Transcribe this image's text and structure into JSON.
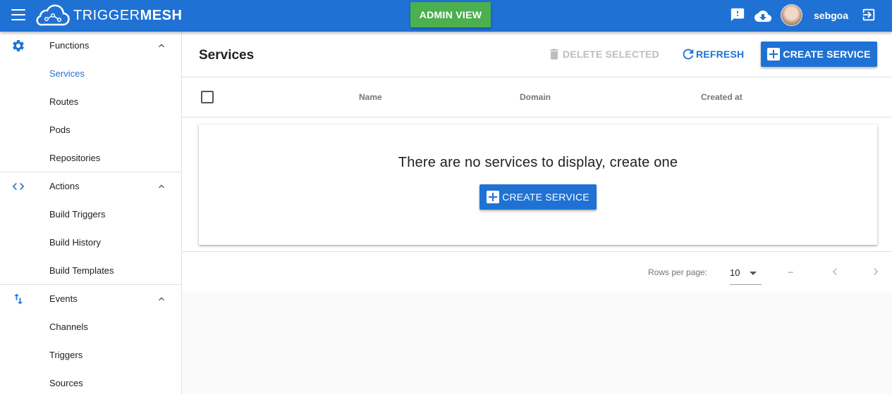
{
  "app": {
    "brand_light": "TRIGGER",
    "brand_bold": "MESH",
    "admin_view_label": "ADMIN VIEW",
    "username": "sebgoa",
    "accent_color": "#1f72d4",
    "admin_color": "#4caf50"
  },
  "sidebar": {
    "groups": [
      {
        "label": "Functions",
        "icon": "gear-icon",
        "items": [
          "Services",
          "Routes",
          "Pods",
          "Repositories"
        ]
      },
      {
        "label": "Actions",
        "icon": "code-icon",
        "items": [
          "Build Triggers",
          "Build History",
          "Build Templates"
        ]
      },
      {
        "label": "Events",
        "icon": "swap-vertical-icon",
        "items": [
          "Channels",
          "Triggers",
          "Sources"
        ]
      }
    ],
    "active_item": "Services"
  },
  "main": {
    "title": "Services",
    "delete_label": "DELETE SELECTED",
    "refresh_label": "REFRESH",
    "create_label": "CREATE SERVICE",
    "columns": [
      "Name",
      "Domain",
      "Created at"
    ],
    "empty_message": "There are no services to display, create one",
    "empty_create_label": "CREATE SERVICE"
  },
  "pagination": {
    "rows_per_page_label": "Rows per page:",
    "rows_per_page_value": "10",
    "range_text": "–"
  }
}
